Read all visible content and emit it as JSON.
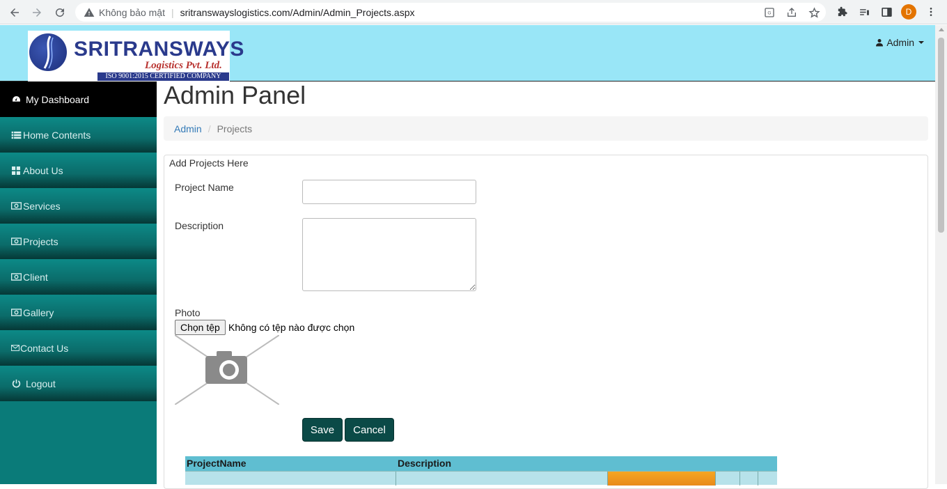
{
  "browser": {
    "security_label": "Không bảo mật",
    "url": "sritranswayslogistics.com/Admin/Admin_Projects.aspx",
    "profile_initial": "D"
  },
  "header": {
    "logo": {
      "brand": "SRITRANSWAYS",
      "tagline": "Logistics Pvt. Ltd.",
      "iso": "ISO 9001:2015 CERTIFIED COMPANY"
    },
    "admin_label": "Admin"
  },
  "sidebar": {
    "items": [
      {
        "label": "My Dashboard",
        "icon": "dashboard-icon"
      },
      {
        "label": "Home Contents",
        "icon": "list-icon"
      },
      {
        "label": "About Us",
        "icon": "grid-icon"
      },
      {
        "label": "Services",
        "icon": "money-icon"
      },
      {
        "label": "Projects",
        "icon": "money-icon"
      },
      {
        "label": "Client",
        "icon": "money-icon"
      },
      {
        "label": "Gallery",
        "icon": "money-icon"
      },
      {
        "label": "Contact Us",
        "icon": "envelope-icon"
      },
      {
        "label": "Logout",
        "icon": "power-icon"
      }
    ]
  },
  "main": {
    "title": "Admin Panel",
    "breadcrumb": {
      "root": "Admin",
      "current": "Projects"
    },
    "form": {
      "legend": "Add Projects Here",
      "project_name_label": "Project Name",
      "project_name_value": "",
      "description_label": "Description",
      "description_value": "",
      "photo_label": "Photo",
      "file_button": "Chọn tệp",
      "file_status": "Không có tệp nào được chọn",
      "save_label": "Save",
      "cancel_label": "Cancel"
    },
    "grid": {
      "columns": [
        "ProjectName",
        "Description"
      ]
    }
  },
  "colors": {
    "header_bg": "#99e6f7",
    "sidebar_bg": "#0a7b79",
    "button_bg": "#0b4a47",
    "grid_header": "#5fbed1"
  }
}
